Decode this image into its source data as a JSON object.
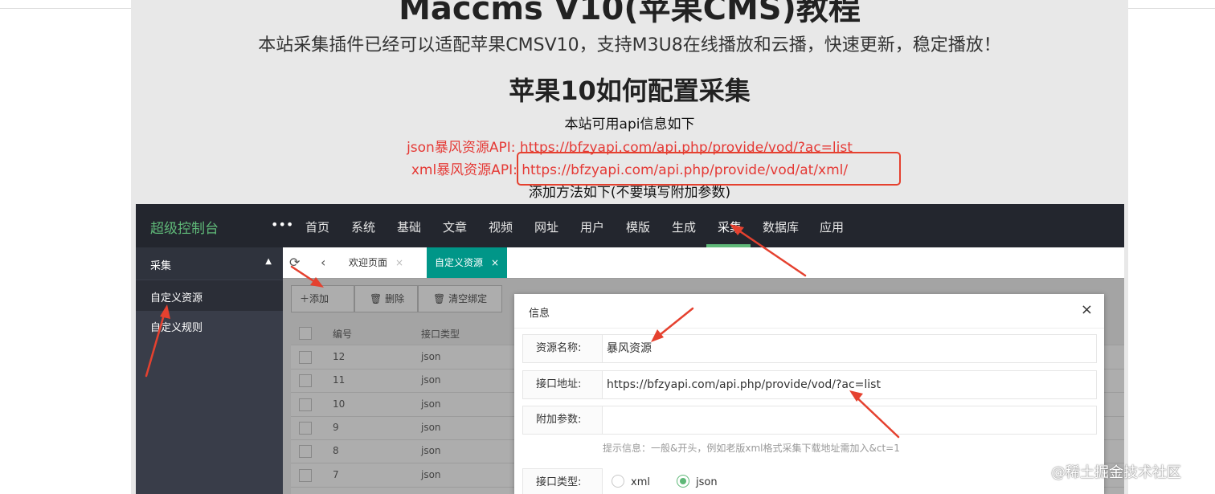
{
  "article": {
    "title_partial": "Maccms V10(苹果CMS)教程",
    "subtitle": "本站采集插件已经可以适配苹果CMSV10，支持M3U8在线播放和云播，快速更新，稳定播放！",
    "heading": "苹果10如何配置采集",
    "api_intro": "本站可用api信息如下",
    "json_api": "json暴风资源API: https://bfzyapi.com/api.php/provide/vod/?ac=list",
    "xml_api": "xml暴风资源API: https://bfzyapi.com/api.php/provide/vod/at/xml/",
    "add_method": "添加方法如下(不要填写附加参数)"
  },
  "colors": {
    "nav_bg": "#23262e",
    "accent_green": "#5fb878",
    "link_red": "#e53935",
    "annotation_red": "#e5412f",
    "sidebar_bg": "#393d49"
  },
  "admin": {
    "brand": "超级控制台",
    "more": "•••",
    "nav": [
      "首页",
      "系统",
      "基础",
      "文章",
      "视频",
      "网址",
      "用户",
      "模版",
      "生成",
      "采集",
      "数据库",
      "应用"
    ],
    "active_nav": "采集",
    "sidebar": {
      "group": "采集",
      "items": [
        "自定义资源",
        "自定义规则"
      ]
    },
    "tabs": [
      {
        "label": "欢迎页面",
        "close": "×"
      },
      {
        "label": "自定义资源",
        "close": "×"
      }
    ],
    "toolbar": {
      "add": "添加",
      "delete": "删除",
      "clear": "清空绑定"
    },
    "table": {
      "headers": [
        "编号",
        "接口类型"
      ],
      "rows": [
        {
          "id": "12",
          "type": "json"
        },
        {
          "id": "11",
          "type": "json"
        },
        {
          "id": "10",
          "type": "json"
        },
        {
          "id": "9",
          "type": "json"
        },
        {
          "id": "8",
          "type": "json"
        },
        {
          "id": "7",
          "type": "json"
        }
      ]
    },
    "dialog": {
      "title": "信息",
      "close": "×",
      "name_label": "资源名称:",
      "name_value": "暴风资源",
      "url_label": "接口地址:",
      "url_value": "https://bfzyapi.com/api.php/provide/vod/?ac=list",
      "params_label": "附加参数:",
      "params_value": "",
      "hint": "提示信息：一般&开头，例如老版xml格式采集下载地址需加入&ct=1",
      "type_label": "接口类型:",
      "type_options": [
        "xml",
        "json"
      ],
      "type_selected": "json"
    }
  },
  "watermark": "@稀土掘金技术社区"
}
